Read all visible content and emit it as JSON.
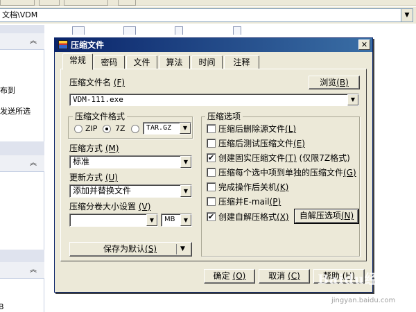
{
  "explorer": {
    "address_text": "文档\\VDM",
    "pane_texts": [
      "布到",
      "发送所选",
      "B"
    ]
  },
  "dialog": {
    "title": "压缩文件",
    "close_icon": "close-icon",
    "tabs": [
      "常规",
      "密码",
      "文件",
      "算法",
      "时间",
      "注释"
    ],
    "active_tab": "常规",
    "archive_name": {
      "label": "压缩文件名",
      "hotkey": "(F)",
      "value": "VDM-111.exe"
    },
    "browse_button": {
      "label": "浏览",
      "hotkey": "(B)"
    },
    "format": {
      "title": "压缩文件格式",
      "options": [
        "ZIP",
        "7Z"
      ],
      "selected": "7Z",
      "third_option": "TAR.GZ"
    },
    "method": {
      "label": "压缩方式",
      "hotkey": "(M)",
      "value": "标准"
    },
    "update": {
      "label": "更新方式",
      "hotkey": "(U)",
      "value": "添加并替换文件"
    },
    "volume": {
      "label": "压缩分卷大小设置",
      "hotkey": "(V)",
      "value": "",
      "unit": "MB"
    },
    "save_default_button": {
      "label": "保存为默认",
      "hotkey": "(S)"
    },
    "options": {
      "title": "压缩选项",
      "items": [
        {
          "label": "压缩后删除源文件",
          "hotkey": "(L)",
          "checked": false,
          "mark": ""
        },
        {
          "label": "压缩后测试压缩文件",
          "hotkey": "(E)",
          "checked": false,
          "mark": ""
        },
        {
          "label": "创建固实压缩文件",
          "hotkey": "(T)",
          "suffix": "(仅限7Z格式)",
          "checked": true,
          "mark": "✔"
        },
        {
          "label": "压缩每个选中项到单独的压缩文件",
          "hotkey": "(G)",
          "checked": false,
          "mark": ""
        },
        {
          "label": "完成操作后关机",
          "hotkey": "(K)",
          "checked": false,
          "mark": ""
        },
        {
          "label": "压缩并E-mail",
          "hotkey": "(P)",
          "checked": false,
          "mark": ""
        },
        {
          "label": "创建自解压格式",
          "hotkey": "(X)",
          "checked": true,
          "mark": "✔"
        }
      ],
      "sfx_button": {
        "label": "自解压选项",
        "hotkey": "(N)"
      }
    },
    "footer": {
      "ok": {
        "label": "确定",
        "hotkey": "(O)"
      },
      "cancel": {
        "label": "取消",
        "hotkey": "(C)"
      },
      "help": {
        "label": "帮助",
        "hotkey": "(H)"
      }
    }
  },
  "watermark": {
    "text": "Baidu经验",
    "url": "jingyan.baidu.com"
  },
  "colors": {
    "titlebar_start": "#0a246a",
    "titlebar_end": "#3a6ea5",
    "dialog_bg": "#ece9d8"
  }
}
